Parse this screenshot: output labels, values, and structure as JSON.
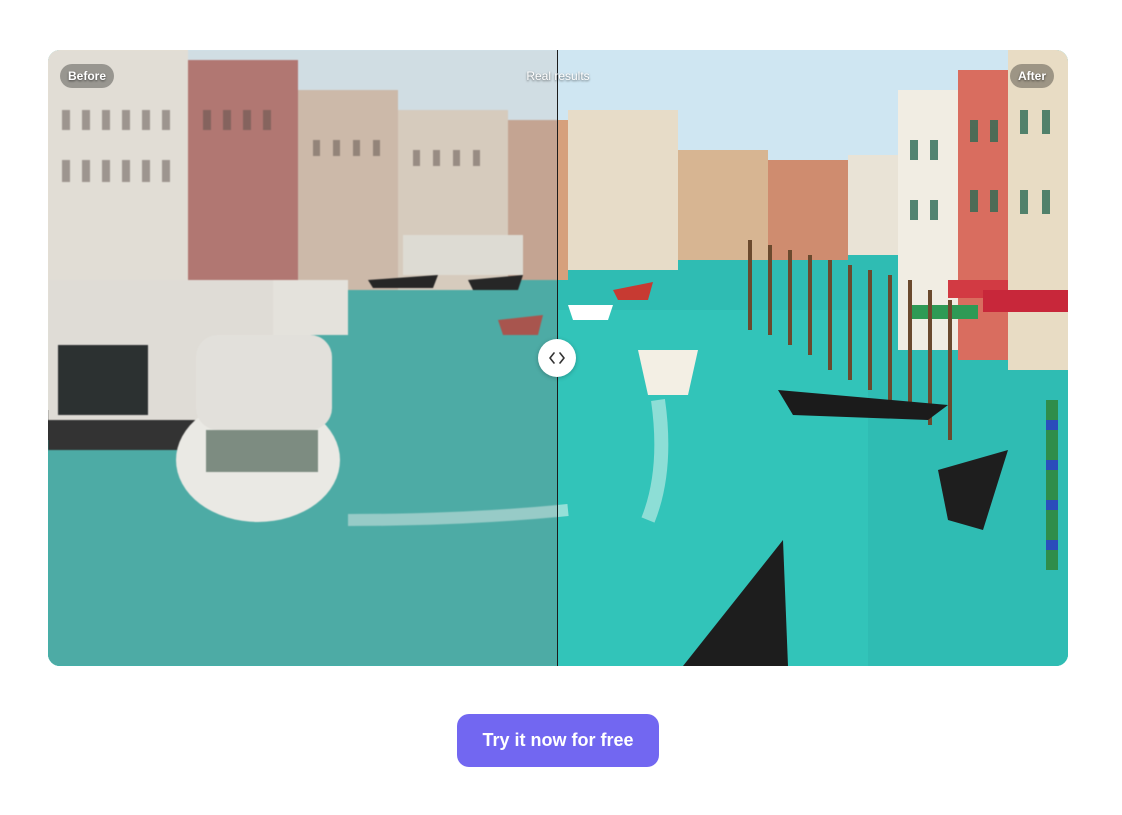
{
  "comparison": {
    "before_label": "Before",
    "center_label": "Real results",
    "after_label": "After",
    "handle_icon": "code-arrows-icon",
    "split_position_percent": 50
  },
  "cta": {
    "label": "Try it now for free",
    "color": "#7267f1"
  },
  "images": {
    "subject": "Venice Grand Canal with gondolas and boats",
    "before_style": "desaturated",
    "after_style": "vivid"
  }
}
